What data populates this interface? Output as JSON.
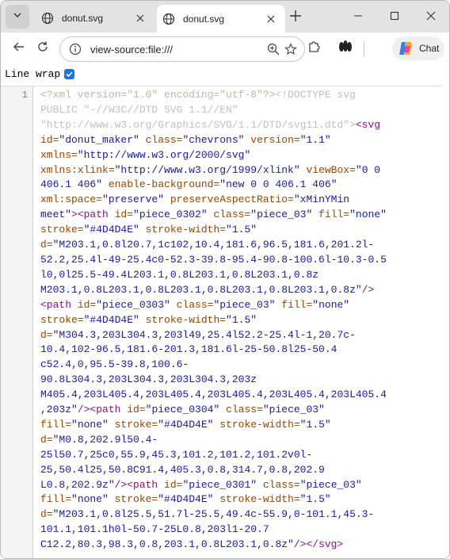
{
  "tabs": [
    {
      "title": "donut.svg",
      "active": false
    },
    {
      "title": "donut.svg",
      "active": true
    }
  ],
  "toolbar": {
    "url": "view-source:file:///",
    "chat_label": "Chat"
  },
  "viewer": {
    "line_wrap_label": "Line wrap",
    "line_wrap_checked": true,
    "line_number": "1"
  },
  "source_lines": [
    [
      [
        "pi",
        "<?xml version=\"1.0\" encoding=\"utf-8\"?>"
      ],
      [
        "doctype",
        "<!DOCTYPE svg"
      ]
    ],
    [
      [
        "doctype",
        "PUBLIC \"-//W3C//DTD SVG 1.1//EN\""
      ]
    ],
    [
      [
        "doctype",
        "\"http://www.w3.org/Graphics/SVG/1.1/DTD/svg11.dtd\">"
      ],
      [
        "tag",
        "<svg"
      ]
    ],
    [
      [
        "attr",
        "id="
      ],
      [
        "val",
        "\"donut_maker\" "
      ],
      [
        "attr",
        "class="
      ],
      [
        "val",
        "\"chevrons\" "
      ],
      [
        "attr",
        "version="
      ],
      [
        "val",
        "\"1.1\""
      ]
    ],
    [
      [
        "attr",
        "xmlns="
      ],
      [
        "val",
        "\"http://www.w3.org/2000/svg\""
      ]
    ],
    [
      [
        "attr",
        "xmlns:xlink="
      ],
      [
        "val",
        "\"http://www.w3.org/1999/xlink\" "
      ],
      [
        "attr",
        "viewBox="
      ],
      [
        "val",
        "\"0 0"
      ]
    ],
    [
      [
        "val",
        "406.1 406\" "
      ],
      [
        "attr",
        "enable-background="
      ],
      [
        "val",
        "\"new 0 0 406.1 406\""
      ]
    ],
    [
      [
        "attr",
        "xml:space="
      ],
      [
        "val",
        "\"preserve\" "
      ],
      [
        "attr",
        "preserveAspectRatio="
      ],
      [
        "val",
        "\"xMinYMin"
      ]
    ],
    [
      [
        "val",
        "meet\""
      ],
      [
        "tag",
        "><path "
      ],
      [
        "attr",
        "id="
      ],
      [
        "val",
        "\"piece_0302\" "
      ],
      [
        "attr",
        "class="
      ],
      [
        "val",
        "\"piece_03\" "
      ],
      [
        "attr",
        "fill="
      ],
      [
        "val",
        "\"none\""
      ]
    ],
    [
      [
        "attr",
        "stroke="
      ],
      [
        "val",
        "\"#4D4D4E\" "
      ],
      [
        "attr",
        "stroke-width="
      ],
      [
        "val",
        "\"1.5\""
      ]
    ],
    [
      [
        "attr",
        "d="
      ],
      [
        "val",
        "\"M203.1,0.8l20.7,1c102,10.4,181.6,96.5,181.6,201.2l-"
      ]
    ],
    [
      [
        "val",
        "52.2,25.4l-49-25.4c0-52.3-39.8-95.4-90.8-100.6l-10.3-0.5"
      ]
    ],
    [
      [
        "val",
        "l0,0l25.5-49.4L203.1,0.8L203.1,0.8L203.1,0.8z"
      ]
    ],
    [
      [
        "val",
        "M203.1,0.8L203.1,0.8L203.1,0.8L203.1,0.8L203.1,0.8z\""
      ],
      [
        "tag",
        "/>"
      ]
    ],
    [
      [
        "tag",
        "<path "
      ],
      [
        "attr",
        "id="
      ],
      [
        "val",
        "\"piece_0303\" "
      ],
      [
        "attr",
        "class="
      ],
      [
        "val",
        "\"piece_03\" "
      ],
      [
        "attr",
        "fill="
      ],
      [
        "val",
        "\"none\""
      ]
    ],
    [
      [
        "attr",
        "stroke="
      ],
      [
        "val",
        "\"#4D4D4E\" "
      ],
      [
        "attr",
        "stroke-width="
      ],
      [
        "val",
        "\"1.5\""
      ]
    ],
    [
      [
        "attr",
        "d="
      ],
      [
        "val",
        "\"M304.3,203L304.3,203l49,25.4l52.2-25.4l-1,20.7c-"
      ]
    ],
    [
      [
        "val",
        "10.4,102-96.5,181.6-201.3,181.6l-25-50.8l25-50.4"
      ]
    ],
    [
      [
        "val",
        "c52.4,0,95.5-39.8,100.6-"
      ]
    ],
    [
      [
        "val",
        "90.8L304.3,203L304.3,203L304.3,203z"
      ]
    ],
    [
      [
        "val",
        "M405.4,203L405.4,203L405.4,203L405.4,203L405.4,203L405.4"
      ]
    ],
    [
      [
        "val",
        ",203z\""
      ],
      [
        "tag",
        "/><path "
      ],
      [
        "attr",
        "id="
      ],
      [
        "val",
        "\"piece_0304\" "
      ],
      [
        "attr",
        "class="
      ],
      [
        "val",
        "\"piece_03\""
      ]
    ],
    [
      [
        "attr",
        "fill="
      ],
      [
        "val",
        "\"none\" "
      ],
      [
        "attr",
        "stroke="
      ],
      [
        "val",
        "\"#4D4D4E\" "
      ],
      [
        "attr",
        "stroke-width="
      ],
      [
        "val",
        "\"1.5\""
      ]
    ],
    [
      [
        "attr",
        "d="
      ],
      [
        "val",
        "\"M0.8,202.9l50.4-"
      ]
    ],
    [
      [
        "val",
        "25l50.7,25c0,55.9,45.3,101.2,101.2,101.2v0l-"
      ]
    ],
    [
      [
        "val",
        "25,50.4l25,50.8C91.4,405.3,0.8,314.7,0.8,202.9"
      ]
    ],
    [
      [
        "val",
        "L0.8,202.9z\""
      ],
      [
        "tag",
        "/><path "
      ],
      [
        "attr",
        "id="
      ],
      [
        "val",
        "\"piece_0301\" "
      ],
      [
        "attr",
        "class="
      ],
      [
        "val",
        "\"piece_03\""
      ]
    ],
    [
      [
        "attr",
        "fill="
      ],
      [
        "val",
        "\"none\" "
      ],
      [
        "attr",
        "stroke="
      ],
      [
        "val",
        "\"#4D4D4E\" "
      ],
      [
        "attr",
        "stroke-width="
      ],
      [
        "val",
        "\"1.5\""
      ]
    ],
    [
      [
        "attr",
        "d="
      ],
      [
        "val",
        "\"M203.1,0.8l25.5,51.7l-25.5,49.4c-55.9,0-101.1,45.3-"
      ]
    ],
    [
      [
        "val",
        "101.1,101.1h0l-50.7-25L0.8,203l1-20.7"
      ]
    ],
    [
      [
        "val",
        "C12.2,80.3,98.3,0.8,203.1,0.8L203.1,0.8z\""
      ],
      [
        "tag",
        "/></svg>"
      ]
    ]
  ],
  "colors": {
    "tag": "#881280",
    "attr": "#994500",
    "val": "#1a1aa6",
    "pi": "#c0b7a0",
    "doctype": "#c0c0c0",
    "accent": "#1a73e8"
  }
}
